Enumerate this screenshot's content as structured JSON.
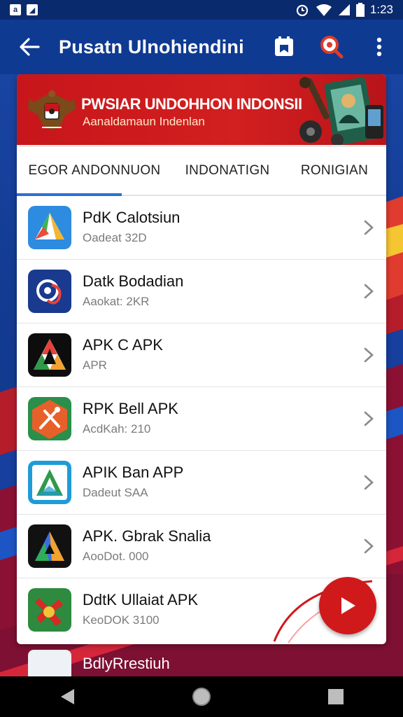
{
  "status_bar": {
    "time": "1:23"
  },
  "app_bar": {
    "title": "Pusatn Ulnohiendini",
    "back_icon": "arrow-left-icon",
    "actions": [
      "bookmark-icon",
      "search-icon",
      "more-vert-icon"
    ]
  },
  "banner": {
    "title": "PWSIAR UNDOHHON INDONSII",
    "subtitle": "Aanaldamaun Indenlan"
  },
  "tabs": [
    {
      "label": "EGOR ANDONNUON",
      "active": true
    },
    {
      "label": "INDONATIGN",
      "active": false
    },
    {
      "label": "RONIGIAN",
      "active": false
    }
  ],
  "apps": [
    {
      "name": "PdK Calotsiun",
      "meta": "Oadeat 32D",
      "icon": "drive-triangle-icon"
    },
    {
      "name": "Datk Bodadian",
      "meta": "Aaokat: 2KR",
      "icon": "swirl-logo-icon"
    },
    {
      "name": "APK C APK",
      "meta": "APR",
      "icon": "triangle-a-icon"
    },
    {
      "name": "RPK Bell APK",
      "meta": "AcdKah: 210",
      "icon": "hexagon-tools-icon"
    },
    {
      "name": "APIK Ban APP",
      "meta": "Dadeut SAA",
      "icon": "android-a-icon"
    },
    {
      "name": "APK. Gbrak Snalia",
      "meta": "AooDot. 000",
      "icon": "color-a-icon"
    },
    {
      "name": "DdtK Ullaiat APK",
      "meta": "KeoDOK 3100",
      "icon": "red-tool-icon"
    }
  ],
  "peek_item": {
    "name": "BdlyRrestiuh"
  },
  "colors": {
    "app_bar": "#0f3a92",
    "banner_red": "#c7161b",
    "tab_indicator": "#2c6fd6",
    "fab_red": "#d0191b"
  }
}
